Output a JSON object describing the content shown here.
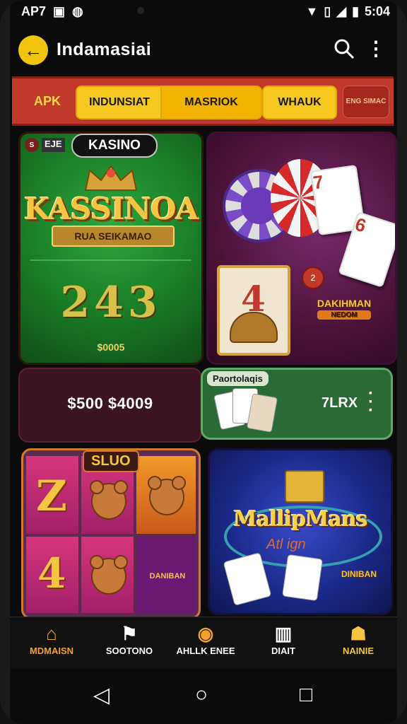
{
  "status": {
    "carrier": "AP7",
    "time": "5:04"
  },
  "appbar": {
    "title": "Indamasiai"
  },
  "tabs": [
    {
      "label": "APK"
    },
    {
      "label": "INDUNSIAT"
    },
    {
      "label": "MASRIOK"
    },
    {
      "label": "WHAUK"
    },
    {
      "label": "ENG SIMAC"
    }
  ],
  "kasino_card": {
    "badge": "KASINO",
    "mini_label": "EJE",
    "logo": "KASSINOA",
    "ribbon": "RUA SEIKAMAO",
    "number": "243",
    "amount": "$0005"
  },
  "chips_card": {
    "card1": "7",
    "card2": "6",
    "tile_number": "4",
    "coin_label": "2",
    "mini_logo": "DAKIHMAN",
    "mini_logo_sub": "NEDOM"
  },
  "balance_card": {
    "text": "$500 $4009"
  },
  "promo_card": {
    "label": "Paortolaqis",
    "value": "7LRX"
  },
  "slots_card": {
    "title": "SLUO",
    "sym1": "Z",
    "sym2": "4",
    "sub": "DANIBAN"
  },
  "mallip_card": {
    "title": "MallipMans",
    "script": "Atl ign",
    "badge": "DINIBAN"
  },
  "bottom_nav": [
    {
      "label": "MDMAISN",
      "icon": "home-icon"
    },
    {
      "label": "SOOTONO",
      "icon": "flag-icon"
    },
    {
      "label": "AHLLK ENEE",
      "icon": "coin-icon"
    },
    {
      "label": "DIAIT",
      "icon": "box-icon"
    },
    {
      "label": "NAINIE",
      "icon": "person-icon"
    }
  ],
  "colors": {
    "accent": "#f2a12a",
    "tabs_bg": "#c0392b",
    "tab_yellow": "#f7c81f"
  }
}
